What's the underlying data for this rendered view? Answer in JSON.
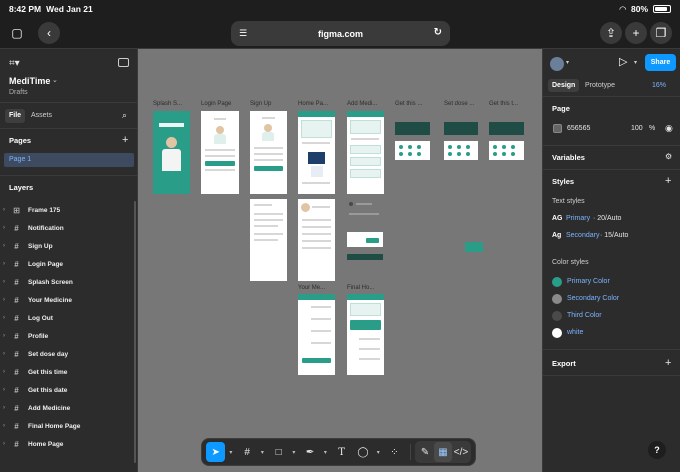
{
  "status": {
    "time": "8:42 PM",
    "date": "Wed Jan 21",
    "battery": "80%"
  },
  "browser": {
    "url": "figma.com"
  },
  "project": {
    "name": "MediTime",
    "location": "Drafts"
  },
  "left_tabs": [
    {
      "label": "File"
    },
    {
      "label": "Assets"
    }
  ],
  "pages": {
    "title": "Pages",
    "items": [
      {
        "label": "Page 1"
      }
    ]
  },
  "layers": {
    "title": "Layers",
    "items": [
      {
        "label": "Frame 175",
        "icon": "frame-icon"
      },
      {
        "label": "Notification",
        "icon": "grid-icon"
      },
      {
        "label": "Sign Up",
        "icon": "grid-icon"
      },
      {
        "label": "Login Page",
        "icon": "grid-icon"
      },
      {
        "label": "Splash Screen",
        "icon": "grid-icon"
      },
      {
        "label": "Your Medicine",
        "icon": "grid-icon"
      },
      {
        "label": "Log Out",
        "icon": "grid-icon"
      },
      {
        "label": "Profile",
        "icon": "grid-icon"
      },
      {
        "label": "Set dose day",
        "icon": "grid-icon"
      },
      {
        "label": "Get this time",
        "icon": "grid-icon"
      },
      {
        "label": "Get this date",
        "icon": "grid-icon"
      },
      {
        "label": "Add Medicine",
        "icon": "grid-icon"
      },
      {
        "label": "Final Home Page",
        "icon": "grid-icon"
      },
      {
        "label": "Home Page",
        "icon": "grid-icon"
      }
    ]
  },
  "canvas": {
    "background": "#777777",
    "frame_labels": [
      "Splash S...",
      "Login Page",
      "Sign Up",
      "Home Pa...",
      "Add Medi...",
      "Get this ...",
      "Set dose ...",
      "Get this t...",
      "Your Me...",
      "Final Ho..."
    ]
  },
  "right_panel": {
    "share_label": "Share",
    "tabs": [
      {
        "label": "Design"
      },
      {
        "label": "Prototype"
      }
    ],
    "zoom": "16%",
    "page": {
      "title": "Page",
      "color": "656565",
      "opacity": "100",
      "opacity_unit": "%"
    },
    "variables_title": "Variables",
    "styles_title": "Styles",
    "text_styles": {
      "title": "Text styles",
      "items": [
        {
          "glyph": "AG",
          "name": "Primary",
          "detail": "· 20/Auto"
        },
        {
          "glyph": "Ag",
          "name": "Secondary",
          "detail": "· 15/Auto"
        }
      ]
    },
    "color_styles": {
      "title": "Color styles",
      "items": [
        {
          "name": "Primary Color",
          "color": "#2a9d88"
        },
        {
          "name": "Secondary Color",
          "color": "#8a8a8a"
        },
        {
          "name": "Third Color",
          "color": "#4a4a4a"
        },
        {
          "name": "white",
          "color": "#ffffff"
        }
      ]
    },
    "export_title": "Export"
  },
  "help_label": "?"
}
